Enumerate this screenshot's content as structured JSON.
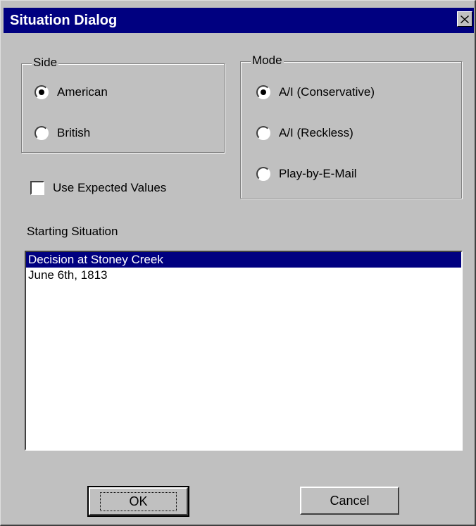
{
  "window": {
    "title": "Situation Dialog",
    "close_icon": "close-icon"
  },
  "side_group": {
    "legend": "Side",
    "options": [
      {
        "label": "American",
        "selected": true
      },
      {
        "label": "British",
        "selected": false
      }
    ]
  },
  "mode_group": {
    "legend": "Mode",
    "options": [
      {
        "label": "A/I (Conservative)",
        "selected": true
      },
      {
        "label": "A/I (Reckless)",
        "selected": false
      },
      {
        "label": "Play-by-E-Mail",
        "selected": false
      }
    ]
  },
  "expected_values": {
    "label": "Use Expected Values",
    "checked": false
  },
  "starting_situation": {
    "label": "Starting Situation",
    "items": [
      {
        "text": "Decision at Stoney Creek",
        "selected": true
      },
      {
        "text": "June 6th, 1813",
        "selected": false
      }
    ]
  },
  "buttons": {
    "ok_label": "OK",
    "cancel_label": "Cancel"
  },
  "colors": {
    "titlebar": "#000080",
    "dialog_face": "#c0c0c0",
    "selection": "#000080"
  }
}
